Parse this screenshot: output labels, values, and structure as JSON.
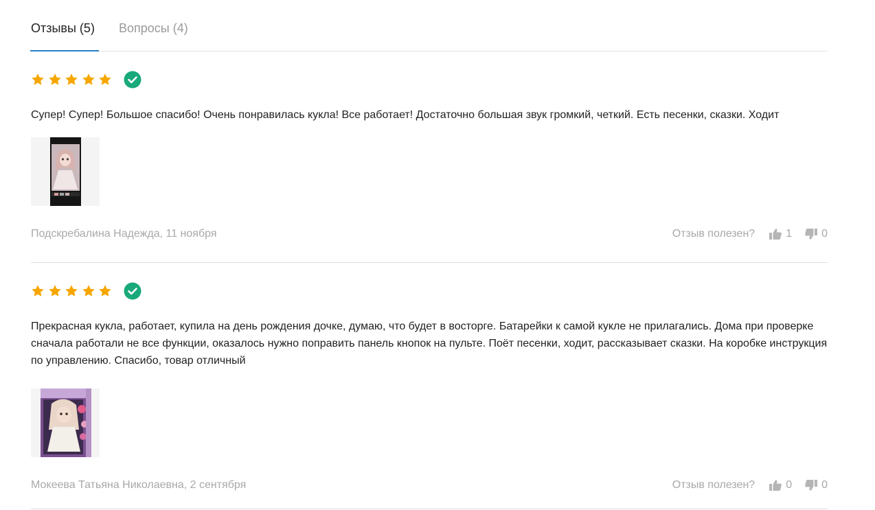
{
  "tabs": [
    {
      "label": "Отзывы (5)",
      "active": true
    },
    {
      "label": "Вопросы (4)",
      "active": false
    }
  ],
  "colors": {
    "star": "#f7a600",
    "verified": "#19a97b",
    "accent": "#2a7ec7",
    "muted_text": "#a8a8a8",
    "icon_gray": "#b5b5b5"
  },
  "helpful_label": "Отзыв полезен?",
  "reviews": [
    {
      "rating": 5,
      "verified": true,
      "verified_icon": "check-circle-icon",
      "text": "Супер! Супер! Большое спасибо! Очень понравилась кукла! Все работает! Достаточно большая звук громкий, четкий. Есть песенки, сказки. Ходит",
      "photo": "doll-photo-screenshot",
      "author_date": "Подскребалина Надежда, 11 ноября",
      "likes": "1",
      "dislikes": "0"
    },
    {
      "rating": 5,
      "verified": true,
      "verified_icon": "check-circle-icon",
      "text": "Прекрасная кукла, работает, купила на день рождения дочке, думаю, что будет в восторге. Батарейки к самой кукле не прилагались. Дома при проверке сначала работали не все функции, оказалось нужно поправить панель кнопок на пульте. Поёт песенки, ходит, рассказывает сказки. На коробке инструкция по управлению. Спасибо, товар отличный",
      "photo": "doll-box-photo",
      "author_date": "Мокеева Татьяна Николаевна, 2 сентября",
      "likes": "0",
      "dislikes": "0"
    }
  ]
}
